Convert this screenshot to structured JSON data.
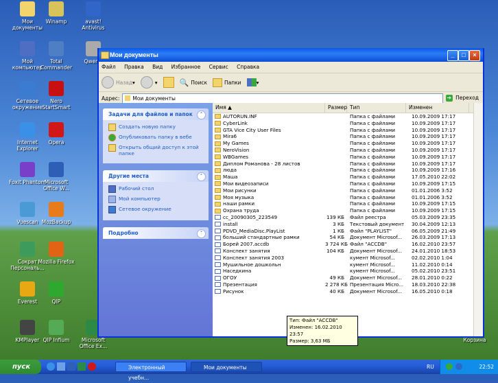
{
  "desktop": {
    "icons": [
      {
        "label": "Мои\nдокументы",
        "color": "#f3d36b"
      },
      {
        "label": "Winamp",
        "color": "#d8c25a"
      },
      {
        "label": "avast!\nAntivirus",
        "color": "#2f66c7"
      },
      {
        "label": "Мой\nкомпьютер",
        "color": "#4d6ec2"
      },
      {
        "label": "Total\nCommander",
        "color": "#4e7fc4"
      },
      {
        "label": "Qwerty",
        "color": "#aaaaaa"
      },
      {
        "label": "Сетевое\nокружение",
        "color": "#3b7bd0"
      },
      {
        "label": "Nero\nStartSmart",
        "color": "#c81010"
      },
      {
        "label": "Internet\nExplorer",
        "color": "#3a8fe6"
      },
      {
        "label": "Opera",
        "color": "#d01818"
      },
      {
        "label": "Foxit Phantom",
        "color": "#7a3fc8"
      },
      {
        "label": "Microsoft\nOffice W...",
        "color": "#2c5fb5"
      },
      {
        "label": "Vuescan",
        "color": "#4a9ad6"
      },
      {
        "label": "MozBackup",
        "color": "#e87b1a"
      },
      {
        "label": "Сократ\nПерсональ...",
        "color": "#3d9c5c"
      },
      {
        "label": "Mozilla Firefox",
        "color": "#e06414"
      },
      {
        "label": "Everest",
        "color": "#e8a814"
      },
      {
        "label": "QIP",
        "color": "#2ea82e"
      },
      {
        "label": "KMPlayer",
        "color": "#444444"
      },
      {
        "label": "QIP Infium",
        "color": "#55aa55"
      },
      {
        "label": "Microsoft\nOffice Ex...",
        "color": "#2d8a45"
      },
      {
        "label": "Корзина",
        "color": "#7a9fc9"
      }
    ]
  },
  "window": {
    "title": "Мои документы",
    "menu": [
      "Файл",
      "Правка",
      "Вид",
      "Избранное",
      "Сервис",
      "Справка"
    ],
    "toolbar": {
      "back": "Назад",
      "search": "Поиск",
      "folders": "Папки"
    },
    "address": {
      "label": "Адрес:",
      "value": "Мои документы",
      "go": "Переход"
    }
  },
  "tasks": {
    "file_tasks": {
      "title": "Задачи для файлов и папок",
      "items": [
        "Создать новую папку",
        "Опубликовать папку в вебе",
        "Открыть общий доступ к этой папке"
      ]
    },
    "other_places": {
      "title": "Другие места",
      "items": [
        "Рабочий стол",
        "Мой компьютер",
        "Сетевое окружение"
      ]
    },
    "details": {
      "title": "Подробно"
    }
  },
  "files": {
    "columns": [
      "Имя",
      "Размер",
      "Тип",
      "Изменен"
    ],
    "rows": [
      {
        "name": "AUTORUN.INF",
        "size": "",
        "type": "Папка с файлами",
        "date": "10.09.2009 17:17",
        "folder": true
      },
      {
        "name": "CyberLink",
        "size": "",
        "type": "Папка с файлами",
        "date": "10.09.2009 17:17",
        "folder": true
      },
      {
        "name": "GTA Vice City User Files",
        "size": "",
        "type": "Папка с файлами",
        "date": "10.09.2009 17:17",
        "folder": true
      },
      {
        "name": "Mira6",
        "size": "",
        "type": "Папка с файлами",
        "date": "10.09.2009 17:17",
        "folder": true
      },
      {
        "name": "My Games",
        "size": "",
        "type": "Папка с файлами",
        "date": "10.09.2009 17:17",
        "folder": true
      },
      {
        "name": "NeroVision",
        "size": "",
        "type": "Папка с файлами",
        "date": "10.09.2009 17:17",
        "folder": true
      },
      {
        "name": "WBGames",
        "size": "",
        "type": "Папка с файлами",
        "date": "10.09.2009 17:17",
        "folder": true
      },
      {
        "name": "Диплом Романова - 28 листов",
        "size": "",
        "type": "Папка с файлами",
        "date": "10.09.2009 17:17",
        "folder": true
      },
      {
        "name": "люда",
        "size": "",
        "type": "Папка с файлами",
        "date": "10.09.2009 17:16",
        "folder": true
      },
      {
        "name": "Маша",
        "size": "",
        "type": "Папка с файлами",
        "date": "17.05.2010 22:02",
        "folder": true
      },
      {
        "name": "Мои видеозаписи",
        "size": "",
        "type": "Папка с файлами",
        "date": "10.09.2009 17:15",
        "folder": true
      },
      {
        "name": "Мои рисунки",
        "size": "",
        "type": "Папка с файлами",
        "date": "01.01.2006 3:52",
        "folder": true
      },
      {
        "name": "Моя музыка",
        "size": "",
        "type": "Папка с файлами",
        "date": "01.01.2006 3:52",
        "folder": true
      },
      {
        "name": "наши рамки",
        "size": "",
        "type": "Папка с файлами",
        "date": "10.09.2009 17:15",
        "folder": true
      },
      {
        "name": "Охрана труда",
        "size": "",
        "type": "Папка с файлами",
        "date": "10.09.2009 17:15",
        "folder": true
      },
      {
        "name": "cc_20090305_223549",
        "size": "139 КБ",
        "type": "Файл реестра",
        "date": "05.03.2009 23:35",
        "folder": false
      },
      {
        "name": "install",
        "size": "3 КБ",
        "type": "Текстовый документ",
        "date": "30.04.2009 12:13",
        "folder": false
      },
      {
        "name": "PDVD_MediaDisc.PlayList",
        "size": "1 КБ",
        "type": "Файл \"PLAYLIST\"",
        "date": "06.05.2009 21:49",
        "folder": false
      },
      {
        "name": "больший стандартные рамки",
        "size": "54 КБ",
        "type": "Документ Microsof...",
        "date": "26.03.2009 17:13",
        "folder": false
      },
      {
        "name": "Борей 2007.accdb",
        "size": "3 724 КБ",
        "type": "Файл \"ACCDB\"",
        "date": "16.02.2010 23:57",
        "folder": false
      },
      {
        "name": "Конспект занятия",
        "size": "104 КБ",
        "type": "Документ Microsof...",
        "date": "24.01.2010 18:53",
        "folder": false
      },
      {
        "name": "Конспект занятия 2003",
        "size": "",
        "type": "кумент Microsof...",
        "date": "02.02.2010 1:04",
        "folder": false
      },
      {
        "name": "Мушильное дошкольн",
        "size": "",
        "type": "кумент Microsof...",
        "date": "11.02.2010 0:14",
        "folder": false
      },
      {
        "name": "Наседкина",
        "size": "",
        "type": "кумент Microsof...",
        "date": "05.02.2010 23:51",
        "folder": false
      },
      {
        "name": "ОГОУ",
        "size": "49 КБ",
        "type": "Документ Microsof...",
        "date": "28.01.2010 0:22",
        "folder": false
      },
      {
        "name": "Презентация",
        "size": "2 278 КБ",
        "type": "Презентация Micro...",
        "date": "18.03.2010 22:38",
        "folder": false
      },
      {
        "name": "Рисунок",
        "size": "40 КБ",
        "type": "Документ Microsof...",
        "date": "16.05.2010 0:18",
        "folder": false
      }
    ]
  },
  "tooltip": {
    "line1": "Тип: Файл \"ACCDB\"",
    "line2": "Изменен: 16.02.2010 23:57",
    "line3": "Размер: 3,63 МБ"
  },
  "taskbar": {
    "start": "пуск",
    "items": [
      "Электронный учебн...",
      "Мои документы"
    ],
    "lang": "RU",
    "clock": "22:52"
  }
}
